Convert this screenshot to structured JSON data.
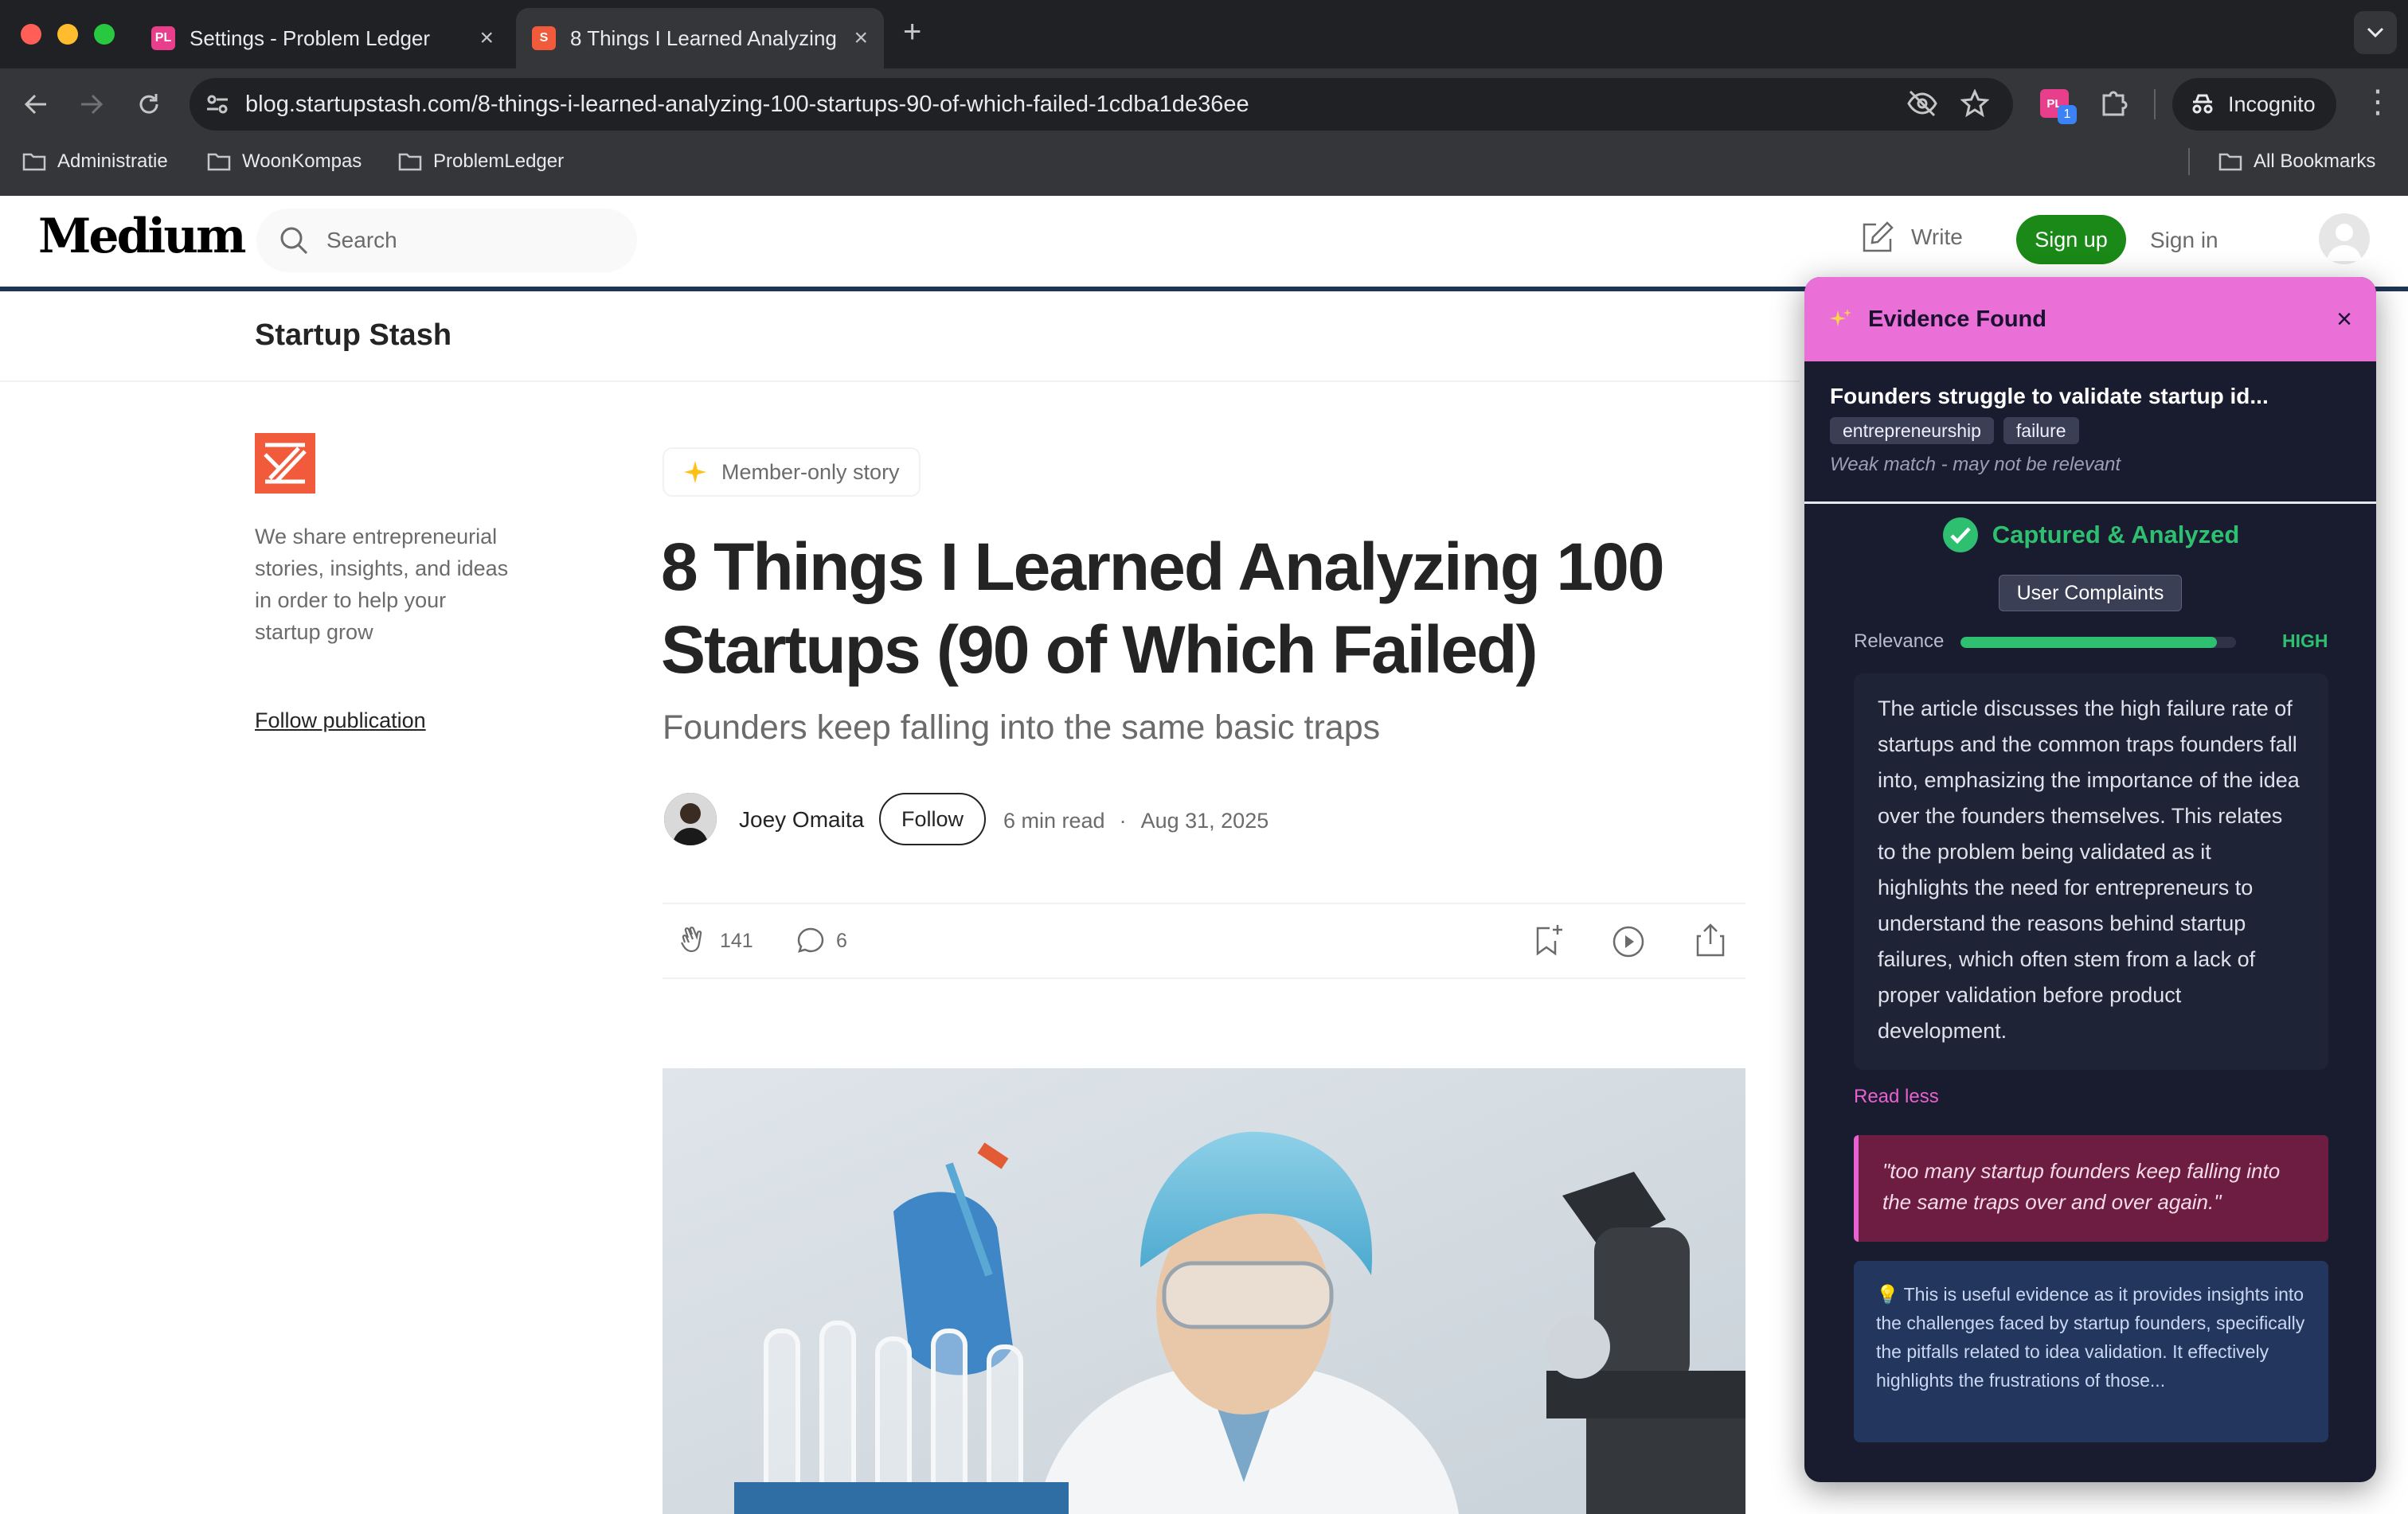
{
  "browser": {
    "tabs": [
      {
        "title": "Settings - Problem Ledger",
        "favicon": "PL"
      },
      {
        "title": "8 Things I Learned Analyzing",
        "favicon": "S"
      }
    ],
    "url": "blog.startupstash.com/8-things-i-learned-analyzing-100-startups-90-of-which-failed-1cdba1de36ee",
    "profile_label": "Incognito",
    "extension_badge": "1",
    "bookmarks": [
      "Administratie",
      "WoonKompas",
      "ProblemLedger"
    ],
    "all_bookmarks": "All Bookmarks"
  },
  "medium": {
    "logo": "Medium",
    "search_placeholder": "Search",
    "write": "Write",
    "signup": "Sign up",
    "signin": "Sign in",
    "publication": "Startup Stash",
    "pub_description": "We share entrepreneurial stories, insights, and ideas in order to help your startup grow",
    "follow_publication": "Follow publication",
    "member_only": "Member-only story",
    "title": "8 Things I Learned Analyzing 100 Startups (90 of Which Failed)",
    "subtitle": "Founders keep falling into the same basic traps",
    "author": "Joey Omaita",
    "follow": "Follow",
    "read_time": "6 min read",
    "separator": "·",
    "date": "Aug 31, 2025",
    "claps": "141",
    "responses": "6"
  },
  "panel": {
    "header": "Evidence Found",
    "problem_title": "Founders struggle to validate startup id...",
    "tags": [
      "entrepreneurship",
      "failure"
    ],
    "match_note": "Weak match - may not be relevant",
    "status": "Captured & Analyzed",
    "category": "User Complaints",
    "relevance_label": "Relevance",
    "relevance_level": "HIGH",
    "relevance_fraction": 0.93,
    "summary": "The article discusses the high failure rate of startups and the common traps founders fall into, emphasizing the importance of the idea over the founders themselves. This relates to the problem being validated as it highlights the need for entrepreneurs to understand the reasons behind startup failures, which often stem from a lack of proper validation before product development.",
    "read_less": "Read less",
    "quote": "\"too many startup founders keep falling into the same traps over and over again.\"",
    "insight": "This is useful evidence as it provides insights into the challenges faced by startup founders, specifically the pitfalls related to idea validation. It effectively highlights the frustrations of those..."
  },
  "colors": {
    "signup_green": "#1a8917",
    "panel_header": "#ea70d8",
    "panel_bg": "#191c2e",
    "accent_green": "#2fbf71",
    "quote_bg": "#6e1d42",
    "insight_bg": "#23365e"
  }
}
